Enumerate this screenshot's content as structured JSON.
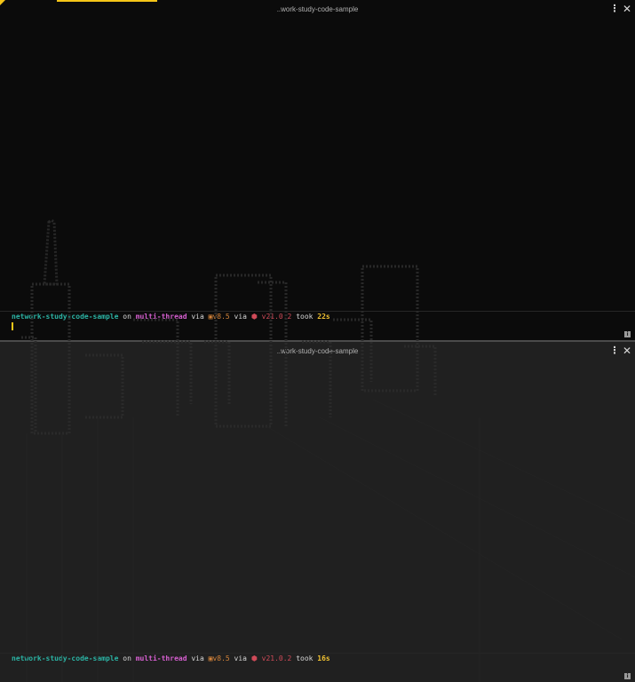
{
  "panes": [
    {
      "title": "..work-study-code-sample",
      "menu_icon": "⋮",
      "close_icon": "✕",
      "info_icon": "i",
      "prompt": {
        "directory": "network-study-code-sample",
        "on": "on",
        "branch_icon": "",
        "branch": "multi-thread",
        "via1": "via",
        "tool_icon": "▣",
        "tool_version": "v8.5",
        "via2": "via",
        "node_icon": "⬢",
        "node_version": "v21.0.2",
        "took": "took",
        "duration": "22s"
      }
    },
    {
      "title": "..work-study-code-sample",
      "menu_icon": "⋮",
      "close_icon": "✕",
      "info_icon": "i",
      "prompt": {
        "directory": "network-study-code-sample",
        "on": "on",
        "branch_icon": "",
        "branch": "multi-thread",
        "via1": "via",
        "tool_icon": "▣",
        "tool_version": "v8.5",
        "via2": "via",
        "node_icon": "⬢",
        "node_version": "v21.0.2",
        "took": "took",
        "duration": "16s"
      }
    }
  ],
  "colors": {
    "accent": "#f5c518",
    "directory": "#2bb3a4",
    "branch": "#d65fd0",
    "tool": "#d3833a",
    "node": "#cf4a58",
    "duration": "#f1c232"
  }
}
